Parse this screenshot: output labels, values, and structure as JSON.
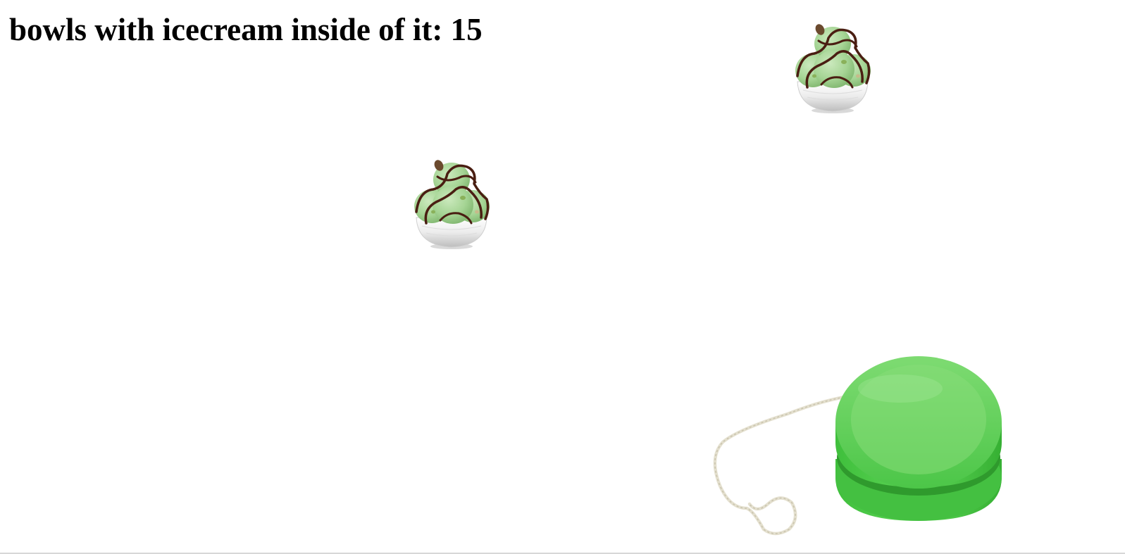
{
  "hud": {
    "score_label": "bowls with icecream inside of it: 15"
  },
  "icons": {
    "bowl": "ice-cream-bowl-icon",
    "player": "yoyo-icon"
  },
  "colors": {
    "background": "#ffffff",
    "text": "#000000",
    "yoyo_green": "#4ccb48",
    "ice_cream_green": "#a8d69a",
    "chocolate": "#4a1e12",
    "bowl": "#eeeeee"
  }
}
